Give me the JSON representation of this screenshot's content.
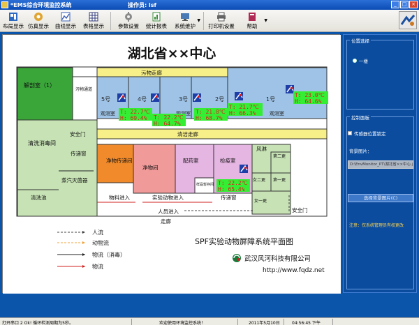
{
  "titlebar": {
    "title": "*EMS综合环境监控系统",
    "operator": "操作员: lsf",
    "buttons": [
      "_",
      "□",
      "×"
    ]
  },
  "toolbar": {
    "items": [
      {
        "label": "布局显示",
        "icon": "layout-icon",
        "color": "#2d6bc2"
      },
      {
        "label": "仿真显示",
        "icon": "simulation-icon",
        "color": "#e0a430"
      },
      {
        "label": "曲线显示",
        "icon": "curve-icon",
        "color": "#3b5fb3"
      },
      {
        "label": "表格显示",
        "icon": "table-icon",
        "color": "#333b7a"
      },
      {
        "label": "参数设置",
        "icon": "settings-icon",
        "color": "#6b6b6b"
      },
      {
        "label": "统计报表",
        "icon": "report-icon",
        "color": "#3a8a3a"
      },
      {
        "label": "系统维护",
        "icon": "maintenance-icon",
        "color": "#4a7ab5"
      },
      {
        "label": "打印机设置",
        "icon": "printer-icon",
        "color": "#555555"
      },
      {
        "label": "帮助",
        "icon": "help-book-icon",
        "color": "#b02a55"
      }
    ]
  },
  "floorplan": {
    "heading": "湖北省××中心",
    "subtitle": "SPF实验动物屏障系统平面图",
    "company": "武汉风河科技有限公司",
    "website": "http://www.fqdz.net",
    "rooms": {
      "dissection": "解剖室（1）",
      "dirty_passage": "污物通道",
      "dirty_corridor": "污物走廊",
      "clean_corridor": "清洁走廊",
      "room5": "5号",
      "room4": "4号",
      "room3": "3号",
      "room2": "2号",
      "room1": "1号",
      "observe": "观测室",
      "safety_door": "安全门",
      "wash_disinfect": "清洗消毒间",
      "pass_window": "传递窗",
      "steam_sterilizer": "蒸汽灭菌器",
      "wash_pool": "清洗池",
      "clean_pass_room": "净物传递间",
      "clean_room": "净物间",
      "prep_room": "配药室",
      "quarantine": "检疫室",
      "sample_room": "样品暂存间",
      "air_shower": "风淋",
      "change2": "第二更",
      "change1": "第一更",
      "buffer": "女二更",
      "female1": "女一更",
      "material_in": "物料进入",
      "animal_in": "实验动物进入",
      "staff_in": "人员进入",
      "walkway": "走廊",
      "pass_window2": "传递窗",
      "safety_door2": "安全门"
    },
    "sensors": [
      {
        "name": "5号",
        "temp": "T: 22.7℃",
        "humi": "H: 69.4%"
      },
      {
        "name": "4号",
        "temp": "T: 22.2℃",
        "humi": "H: 64.7%"
      },
      {
        "name": "3号",
        "temp": "T: 21.8℃",
        "humi": "H: 68.7%"
      },
      {
        "name": "2号",
        "temp": "T: 21.7℃",
        "humi": "H: 66.3%"
      },
      {
        "name": "1号",
        "temp": "T: 23.0℃",
        "humi": "H: 64.6%"
      },
      {
        "name": "检疫室",
        "temp": "T: 22.2℃",
        "humi": "H: 65.4%"
      }
    ],
    "legend": [
      {
        "label": "人流",
        "color": "#444444"
      },
      {
        "label": "动物流",
        "color": "#f2a33a"
      },
      {
        "label": "物流（消毒）",
        "color": "#222222"
      },
      {
        "label": "物流",
        "color": "#d22020"
      }
    ]
  },
  "rightpanel": {
    "position_group": "位置选择",
    "position_option": "一楼",
    "control_group": "控制面板",
    "lock_sensors": "传感器位置锁定",
    "bg_label": "背景图片：",
    "bg_value": "D:\\EnvMonitor_PT\\湖北省××中心.jpg",
    "bg_button": "选择背景图片(C)",
    "note": "注意：仅系统管理员有权更改"
  },
  "statusbar": {
    "port": "打开串口 2 Ok! 循环检测周期为5秒。",
    "welcome": "欢迎使用环境监控系统！",
    "date": "2011年5月10日",
    "time": "04:56:45 下午"
  },
  "colors": {
    "green_room": "#3aa63a",
    "blue_room": "#9ec3e6",
    "yellow_corridor": "#f7f089",
    "orange_room": "#f08a2a",
    "pink_room": "#f19a9a",
    "purple_room": "#e6b6e3",
    "green_light": "#c7e3b5",
    "sensor_green": "#33ee33",
    "sensor_red": "#e02020"
  }
}
